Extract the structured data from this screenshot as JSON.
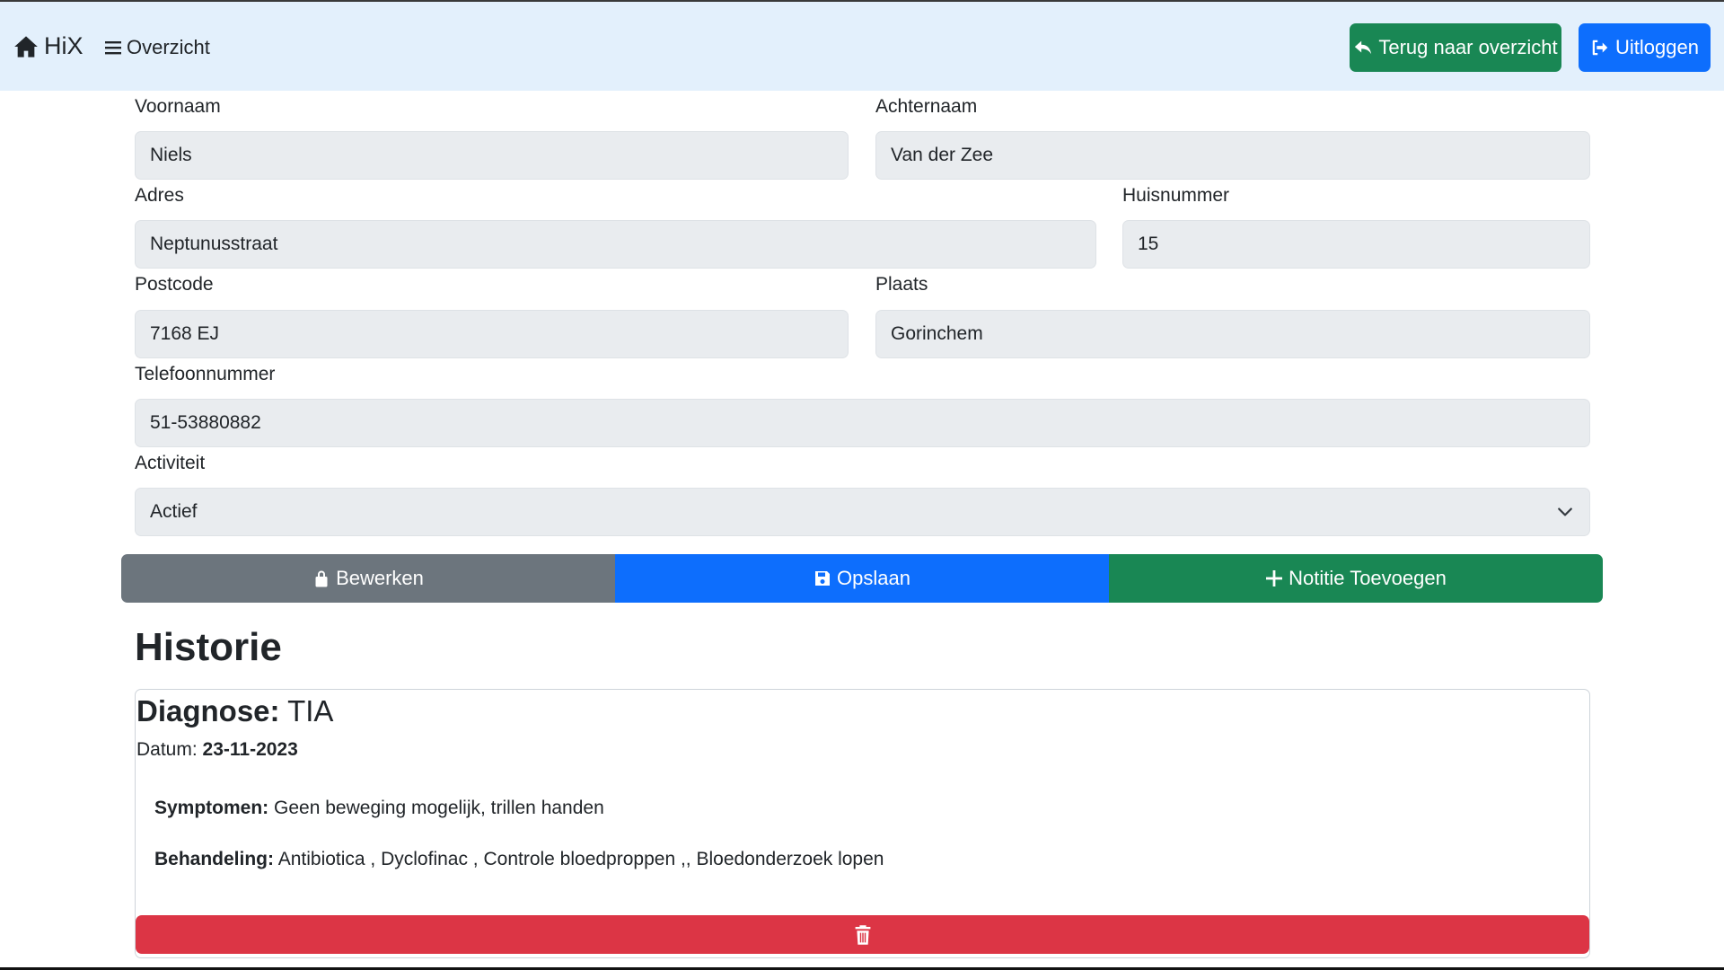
{
  "navbar": {
    "brand": "HiX",
    "overview_link": "Overzicht",
    "back_button": "Terug naar overzicht",
    "logout_button": "Uitloggen"
  },
  "form": {
    "voornaam": {
      "label": "Voornaam",
      "value": "Niels"
    },
    "achternaam": {
      "label": "Achternaam",
      "value": "Van der Zee"
    },
    "adres": {
      "label": "Adres",
      "value": "Neptunusstraat"
    },
    "huisnummer": {
      "label": "Huisnummer",
      "value": "15"
    },
    "postcode": {
      "label": "Postcode",
      "value": "7168 EJ"
    },
    "plaats": {
      "label": "Plaats",
      "value": "Gorinchem"
    },
    "telefoonnummer": {
      "label": "Telefoonnummer",
      "value": "51-53880882"
    },
    "activiteit": {
      "label": "Activiteit",
      "value": "Actief"
    }
  },
  "actions": {
    "edit": "Bewerken",
    "save": "Opslaan",
    "add_note": "Notitie Toevoegen"
  },
  "history": {
    "title": "Historie",
    "entries": [
      {
        "diagnosis_label": "Diagnose:",
        "diagnosis": "TIA",
        "date_label": "Datum:",
        "date": "23-11-2023",
        "symptoms_label": "Symptomen:",
        "symptoms": "Geen beweging mogelijk, trillen handen",
        "treatment_label": "Behandeling:",
        "treatment": "Antibiotica , Dyclofinac , Controle bloedproppen ,, Bloedonderzoek lopen"
      }
    ]
  },
  "colors": {
    "navbar_bg": "#e3f0fc",
    "success": "#198754",
    "primary": "#0d6efd",
    "secondary": "#6c757d",
    "danger": "#dc3545",
    "field_bg": "#e9ecef"
  },
  "icons": [
    "home-icon",
    "hamburger-icon",
    "reply-icon",
    "logout-icon",
    "lock-icon",
    "floppy-icon",
    "plus-icon",
    "trash-icon",
    "chevron-down-icon"
  ]
}
